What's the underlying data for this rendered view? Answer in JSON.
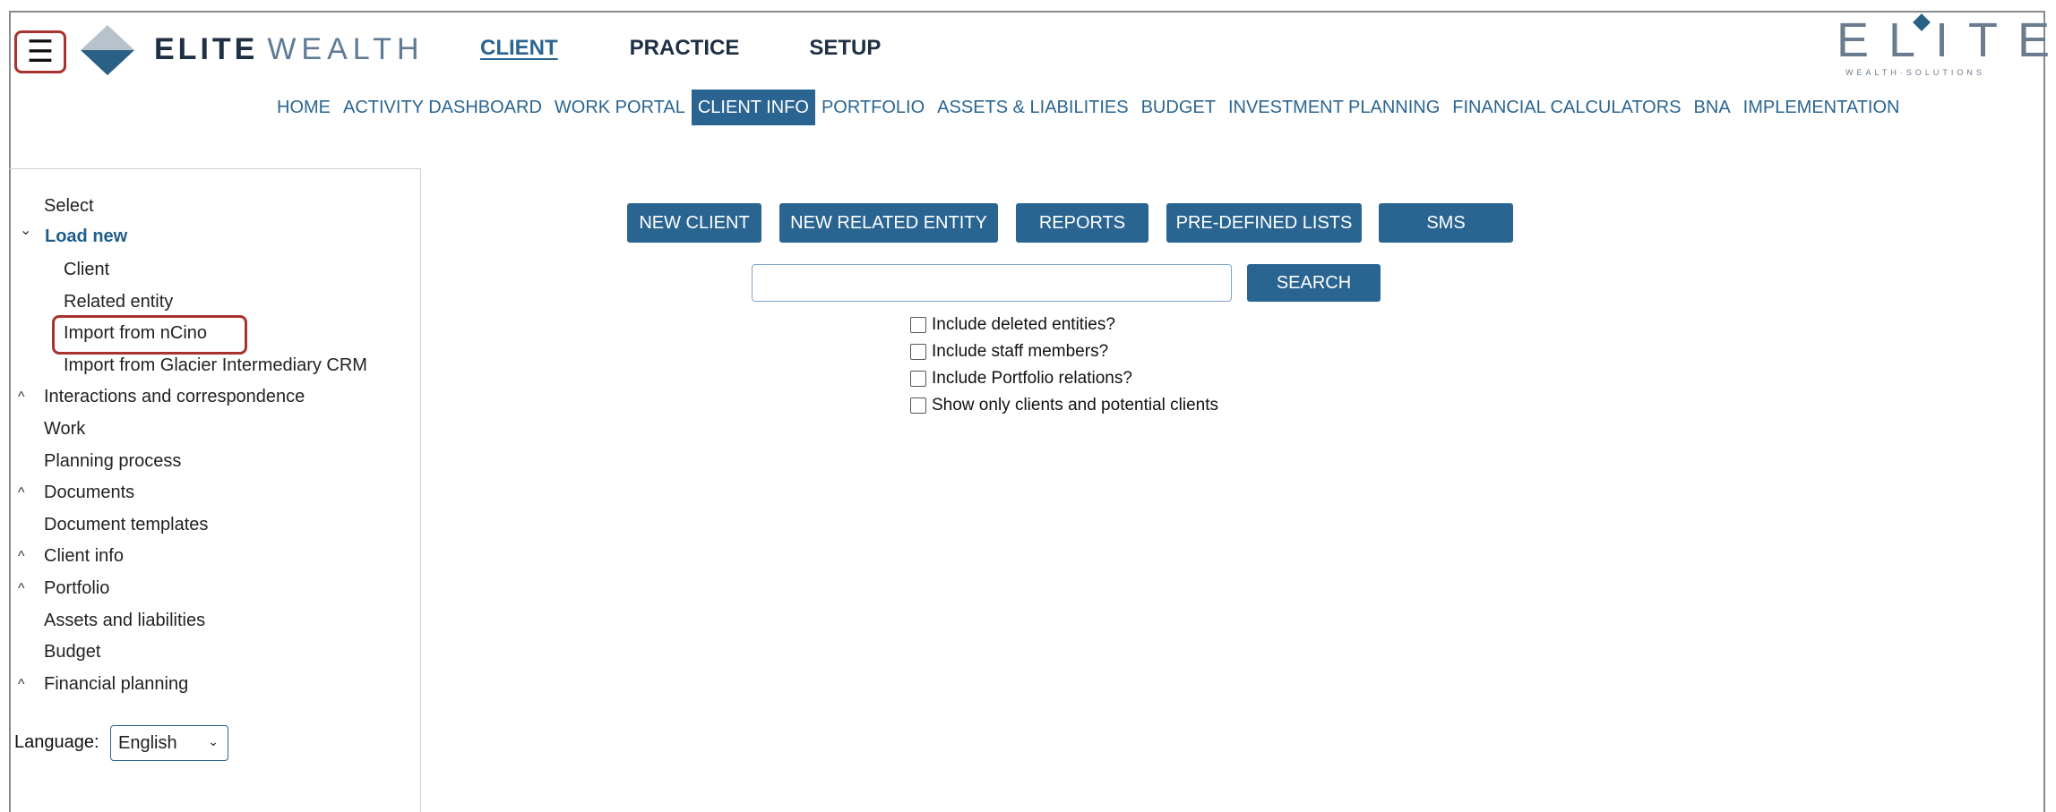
{
  "header": {
    "menu_icon": "hamburger-icon",
    "logo_elite": "ELITE",
    "logo_wealth": "WEALTH",
    "brand_right_big": "ELITE",
    "brand_right_small": "WEALTH·SOLUTIONS",
    "topnav": [
      "CLIENT",
      "PRACTICE",
      "SETUP"
    ],
    "topnav_active": "CLIENT"
  },
  "subnav": {
    "items": [
      "HOME",
      "ACTIVITY DASHBOARD",
      "WORK PORTAL",
      "CLIENT INFO",
      "PORTFOLIO",
      "ASSETS & LIABILITIES",
      "BUDGET",
      "INVESTMENT PLANNING",
      "FINANCIAL CALCULATORS",
      "BNA",
      "IMPLEMENTATION"
    ],
    "active": "CLIENT INFO"
  },
  "sidebar": {
    "items": [
      {
        "label": "Select"
      },
      {
        "label": "Load new"
      },
      {
        "label": "Client"
      },
      {
        "label": "Related entity"
      },
      {
        "label": "Import from nCino"
      },
      {
        "label": "Import from Glacier Intermediary CRM"
      },
      {
        "label": "Interactions and correspondence"
      },
      {
        "label": "Work"
      },
      {
        "label": "Planning process"
      },
      {
        "label": "Documents"
      },
      {
        "label": "Document templates"
      },
      {
        "label": "Client info"
      },
      {
        "label": "Portfolio"
      },
      {
        "label": "Assets and liabilities"
      },
      {
        "label": "Budget"
      },
      {
        "label": "Financial planning"
      }
    ],
    "chevron_expanded": "⌄",
    "chevron_collapsed": "^"
  },
  "language": {
    "label": "Language:",
    "selected": "English"
  },
  "actions": {
    "new_client": "NEW CLIENT",
    "new_related_entity": "NEW RELATED ENTITY",
    "reports": "REPORTS",
    "predefined_lists": "PRE-DEFINED LISTS",
    "sms": "SMS"
  },
  "search": {
    "value": "",
    "placeholder": "",
    "button": "SEARCH"
  },
  "filters": [
    {
      "label": "Include deleted entities?",
      "checked": false
    },
    {
      "label": "Include staff members?",
      "checked": false
    },
    {
      "label": "Include Portfolio relations?",
      "checked": false
    },
    {
      "label": "Show only clients and potential clients",
      "checked": false
    }
  ],
  "colors": {
    "accent": "#2a6592",
    "highlight": "#a8322d"
  }
}
